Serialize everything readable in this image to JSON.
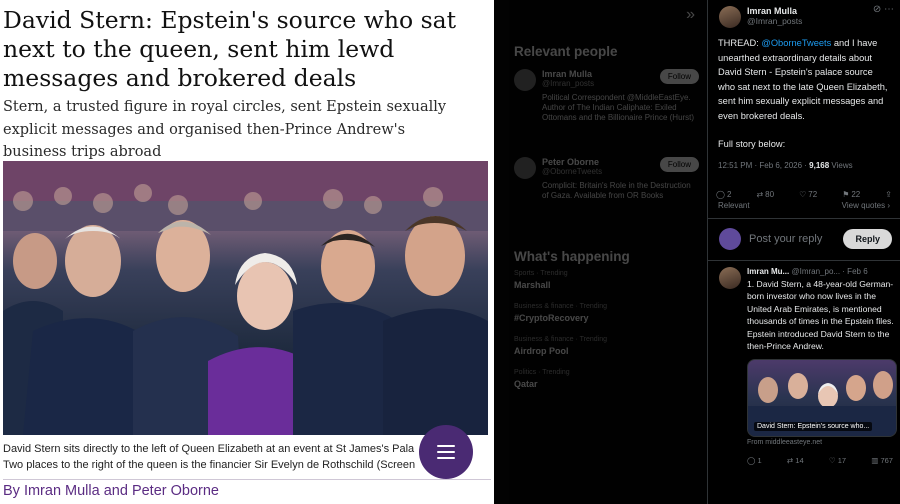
{
  "article": {
    "headline": "David Stern: Epstein's source who sat next to the queen, sent him lewd messages and brokered deals",
    "standfirst": "Stern, a trusted figure in royal circles, sent Epstein sexually explicit messages and organised then-Prince Andrew's business trips abroad",
    "caption_line1": "David Stern sits directly to the left of Queen Elizabeth at an event at St James's Pala",
    "caption_line2": "Two places to the right of the queen is the financier Sir Evelyn de Rothschild (Screen",
    "byline": "By Imran Mulla and Peter Oborne",
    "colors": {
      "byline": "#5b2c83",
      "menu_button": "#4a2a73"
    }
  },
  "sidebar": {
    "collapse_icon": "»",
    "relevant_heading": "Relevant people",
    "people": [
      {
        "name": "Imran Mulla",
        "handle": "@Imran_posts",
        "bio": "Political Correspondent @MiddleEastEye. Author of The Indian Caliphate: Exiled Ottomans and the Billionaire Prince (Hurst)",
        "follow": "Follow"
      },
      {
        "name": "Peter Oborne",
        "handle": "@OborneTweets",
        "bio": "Complicit: Britain's Role in the Destruction of Gaza. Available from OR Books",
        "follow": "Follow"
      }
    ],
    "happening_heading": "What's happening",
    "trends": [
      {
        "meta": "Sports · Trending",
        "name": "Marshall"
      },
      {
        "meta": "Business & finance · Trending",
        "name": "#CryptoRecovery"
      },
      {
        "meta": "Business & finance · Trending",
        "name": "Airdrop Pool"
      },
      {
        "meta": "Politics · Trending",
        "name": "Qatar"
      }
    ]
  },
  "thread": {
    "author": {
      "name": "Imran Mulla",
      "handle": "@Imran_posts"
    },
    "icons": {
      "grok": "grok-icon",
      "more": "more-icon"
    },
    "text_prefix": "THREAD: ",
    "mention": "@OborneTweets",
    "text_rest": " and I have unearthed extraordinary details about David Stern - Epstein's palace source who sat next to the late Queen Elizabeth, sent him sexually explicit messages and even brokered deals.",
    "text_line2": "Full story below:",
    "time": "12:51 PM · Feb 6, 2026 · ",
    "views_count": "9,168",
    "views_label": " Views",
    "stats": {
      "replies": "2",
      "reposts": "80",
      "likes": "72",
      "bookmarks": "22"
    },
    "relevant_label": "Relevant",
    "view_quotes": "View quotes ›",
    "reply_placeholder": "Post your reply",
    "reply_button": "Reply",
    "post2": {
      "name": "Imran Mu...",
      "handle": "@Imran_po...",
      "date": "· Feb 6",
      "text": "1. David Stern, a 48-year-old German-born investor who now lives in the United Arab Emirates, is mentioned thousands of times in the Epstein files. Epstein introduced David Stern to the then-Prince Andrew.",
      "card_label": "David Stern: Epstein's source who...",
      "card_source": "From middleeasteye.net",
      "stats": {
        "replies": "1",
        "reposts": "14",
        "likes": "17",
        "views": "767"
      }
    }
  }
}
